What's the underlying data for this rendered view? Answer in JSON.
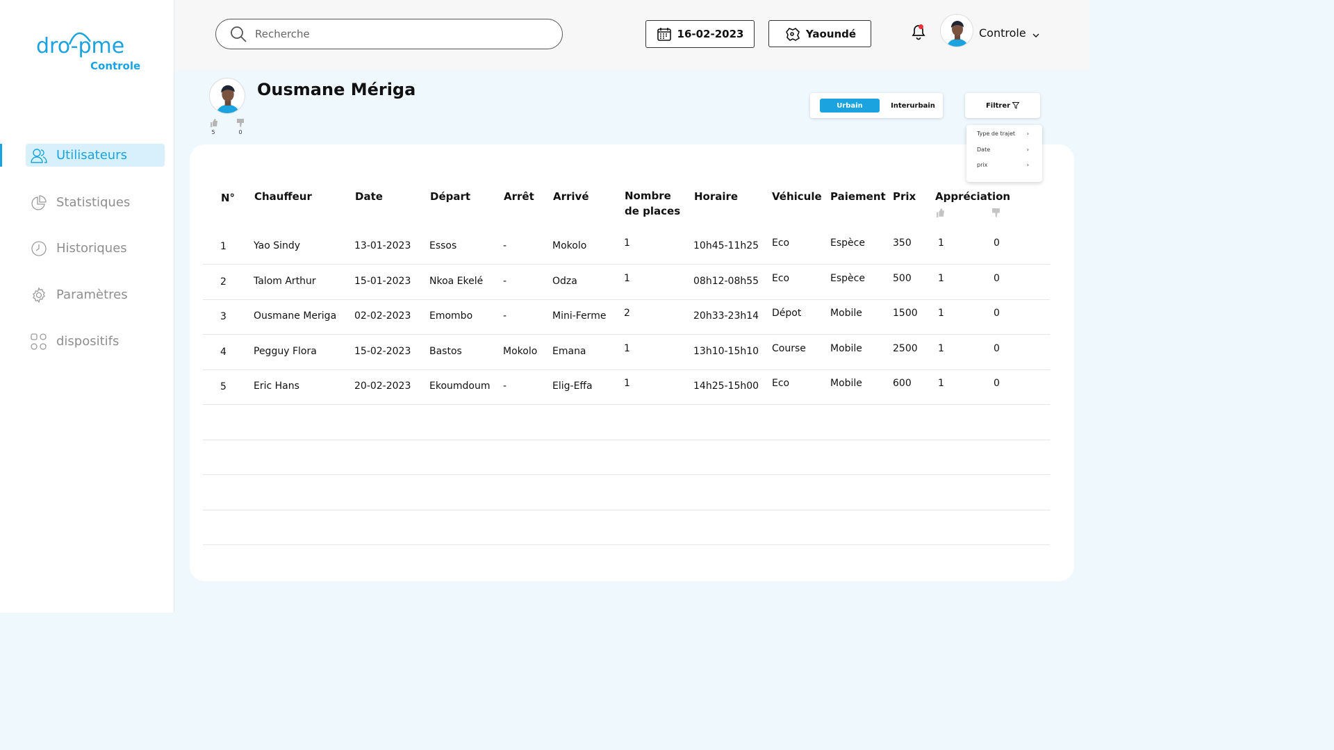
{
  "brand": {
    "logo_text": "dro-pme",
    "sub": "Controle",
    "color": "#1aa3de"
  },
  "sidebar": {
    "items": [
      {
        "label": "Utilisateurs",
        "icon": "users-icon",
        "active": true
      },
      {
        "label": "Statistiques",
        "icon": "pie-chart-icon",
        "active": false
      },
      {
        "label": "Historiques",
        "icon": "clock-icon",
        "active": false
      },
      {
        "label": "Paramètres",
        "icon": "gear-icon",
        "active": false
      },
      {
        "label": "dispositifs",
        "icon": "grid-icon",
        "active": false
      }
    ]
  },
  "header": {
    "search_placeholder": "Recherche",
    "date": "16-02-2023",
    "city": "Yaoundé",
    "user": "Controle"
  },
  "profile": {
    "name": "Ousmane Mériga",
    "likes": "5",
    "dislikes": "0"
  },
  "toggle": {
    "urbain": "Urbain",
    "interurbain": "Interurbain"
  },
  "filter": {
    "label": "Filtrer",
    "menu": [
      "Type de trajet",
      "Date",
      "prix"
    ]
  },
  "table": {
    "headers": [
      "N°",
      "Chauffeur",
      "Date",
      "Départ",
      "Arrêt",
      "Arrivé",
      "Nombre de places",
      "Horaire",
      "Véhicule",
      "Paiement",
      "Prix",
      "Appréciation"
    ],
    "rows": [
      [
        "1",
        "Yao Sindy",
        "13-01-2023",
        "Essos",
        "-",
        "Mokolo",
        "1",
        "10h45-11h25",
        "Eco",
        "Espèce",
        "350",
        "1",
        "0"
      ],
      [
        "2",
        "Talom Arthur",
        "15-01-2023",
        "Nkoa Ekelé",
        "-",
        "Odza",
        "1",
        "08h12-08h55",
        "Eco",
        "Espèce",
        "500",
        "1",
        "0"
      ],
      [
        "3",
        "Ousmane Meriga",
        "02-02-2023",
        "Emombo",
        "-",
        "Mini-Ferme",
        "2",
        "20h33-23h14",
        "Dépot",
        "Mobile",
        "1500",
        "1",
        "0"
      ],
      [
        "4",
        "Pegguy Flora",
        "15-02-2023",
        "Bastos",
        "Mokolo",
        "Emana",
        "1",
        "13h10-15h10",
        "Course",
        "Mobile",
        "2500",
        "1",
        "0"
      ],
      [
        "5",
        "Eric Hans",
        "20-02-2023",
        "Ekoumdoum",
        "-",
        "Elig-Effa",
        "1",
        "14h25-15h00",
        "Eco",
        "Mobile",
        "600",
        "1",
        "0"
      ]
    ]
  }
}
